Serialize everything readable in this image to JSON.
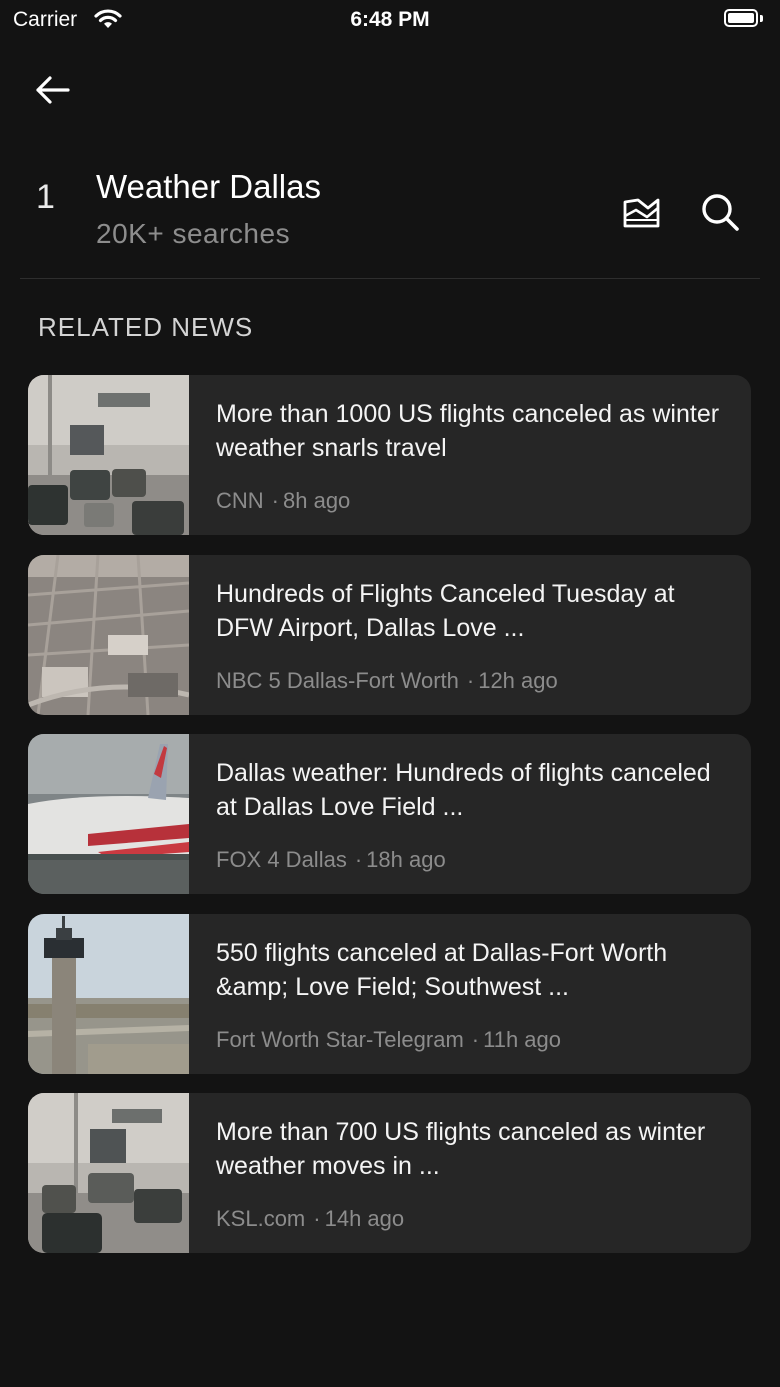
{
  "status_bar": {
    "carrier": "Carrier",
    "time": "6:48 PM"
  },
  "header": {
    "rank": "1",
    "title": "Weather Dallas",
    "subtitle": "20K+ searches"
  },
  "section_heading": "RELATED NEWS",
  "news": [
    {
      "headline": "More than 1000 US flights canceled as winter weather snarls travel",
      "source": "CNN",
      "time": "8h ago"
    },
    {
      "headline": "Hundreds of Flights Canceled Tuesday at DFW Airport, Dallas Love ...",
      "source": "NBC 5 Dallas-Fort Worth",
      "time": "12h ago"
    },
    {
      "headline": "Dallas weather: Hundreds of flights canceled at Dallas Love Field ...",
      "source": "FOX 4 Dallas",
      "time": "18h ago"
    },
    {
      "headline": "550 flights canceled at Dallas-Fort Worth &amp; Love Field; Southwest ...",
      "source": "Fort Worth Star-Telegram",
      "time": "11h ago"
    },
    {
      "headline": "More than 700 US flights canceled as winter weather moves in ...",
      "source": "KSL.com",
      "time": "14h ago"
    }
  ],
  "icons": {
    "back": "arrow-left-icon",
    "chart": "trend-chart-icon",
    "search": "search-icon"
  },
  "colors": {
    "background": "#131313",
    "card": "#262626",
    "secondary_text": "#8c8c8c"
  }
}
